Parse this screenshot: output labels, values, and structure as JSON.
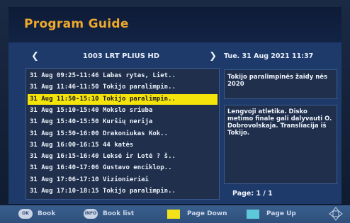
{
  "title": "Program Guide",
  "channel": {
    "name": "1003  LRT PLIUS HD",
    "prev_icon": "chevron-left",
    "next_icon": "chevron-right"
  },
  "datetime": "Tue.   31 Aug 2021 11:37",
  "programs": [
    "31 Aug 09:25-11:46  Labas rytas, Liet..",
    "31 Aug 11:46-11:50  Tokijo paralimpin..",
    "31 Aug 11:50-15:10  Tokijo paralimpin..",
    "31 Aug 15:10-15:40  Mokslo sriuba",
    "31 Aug 15:40-15:50  Kuršių nerija",
    "31 Aug 15:50-16:00  Drakoniukas Kok..",
    "31 Aug 16:00-16:15  44 katės",
    "31 Aug 16:15-16:40  Leksė ir Lotė ? š..",
    "31 Aug 16:40-17:06  Gustavo enciklop..",
    "31 Aug 17:06-17:10  Vizionieriai",
    "31 Aug 17:10-18:15  Tokijo paralimpin.."
  ],
  "selected_index": 2,
  "info_title": "Tokijo paralimpinės žaidy nės 2020",
  "info_desc": "Lengvoji atletika. Disko metimo finale gali dalyvauti O. Dobrovolskaja. Transliacija iš Tokijo.",
  "page": "Page:  1 / 1",
  "footer": {
    "book_key": "OK",
    "book": "Book",
    "booklist_key": "INFO",
    "booklist": "Book list",
    "pagedown": "Page Down",
    "pageup": "Page Up",
    "pagedown_color": "#f2e21a",
    "pageup_color": "#5cc8d8"
  }
}
